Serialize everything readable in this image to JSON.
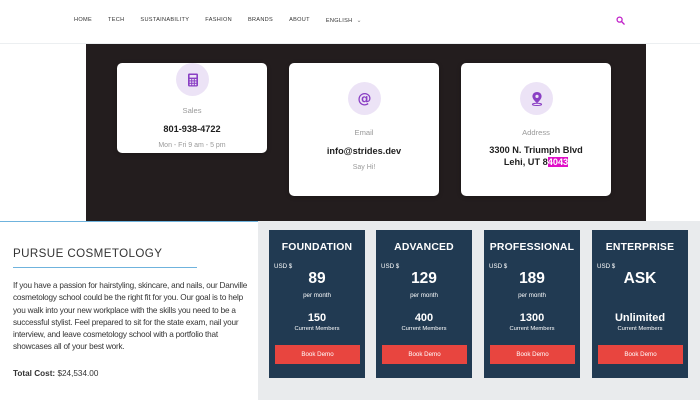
{
  "nav": {
    "items": [
      "HOME",
      "TECH",
      "SUSTAINABILITY",
      "FASHION",
      "BRANDS",
      "ABOUT",
      "ENGLISH"
    ],
    "language_chevron_icon": "chevron-down-icon",
    "search_icon": "search-icon",
    "accent_color": "#c020c8"
  },
  "contact": {
    "sales": {
      "icon": "calculator-icon",
      "label": "Sales",
      "value": "801-938-4722",
      "sub": "Mon - Fri 9 am - 5 pm"
    },
    "email": {
      "icon": "at-sign-icon",
      "label": "Email",
      "value": "info@strides.dev",
      "sub": "Say Hi!"
    },
    "address": {
      "icon": "map-pin-icon",
      "label": "Address",
      "line1": "3300 N. Triumph Blvd",
      "line2_prefix": "Lehi, UT 8",
      "line2_highlight": "4043",
      "highlight_color": "#e010c8"
    }
  },
  "pursue": {
    "title": "PURSUE COSMETOLOGY",
    "body": "If you have a passion for hairstyling, skincare, and nails, our Danville cosmetology school could be the right fit for you. Our goal is to help you walk into your new workplace with the skills you need to be a successful stylist. Feel prepared to sit for the state exam, nail your interview, and leave cosmetology school with a portfolio that showcases all of your best work.",
    "total_label": "Total Cost:",
    "total_value": "$24,534.00"
  },
  "plans": [
    {
      "name": "FOUNDATION",
      "currency": "USD $",
      "price": "89",
      "period": "per month",
      "members": "150",
      "members_label": "Current Members",
      "button": "Book Demo"
    },
    {
      "name": "ADVANCED",
      "currency": "USD $",
      "price": "129",
      "period": "per month",
      "members": "400",
      "members_label": "Current Members",
      "button": "Book Demo"
    },
    {
      "name": "PROFESSIONAL",
      "currency": "USD $",
      "price": "189",
      "period": "per month",
      "members": "1300",
      "members_label": "Current Members",
      "button": "Book Demo"
    },
    {
      "name": "ENTERPRISE",
      "currency": "USD $",
      "price": "ASK",
      "period": "",
      "members": "Unlimited",
      "members_label": "Current Members",
      "button": "Book Demo"
    }
  ],
  "colors": {
    "band": "#231d1e",
    "plan_card": "#213a52",
    "button": "#e8453f",
    "icon_bg": "#ece3f6",
    "icon_fg": "#8a3fc4",
    "underline": "#6fb3dd"
  }
}
